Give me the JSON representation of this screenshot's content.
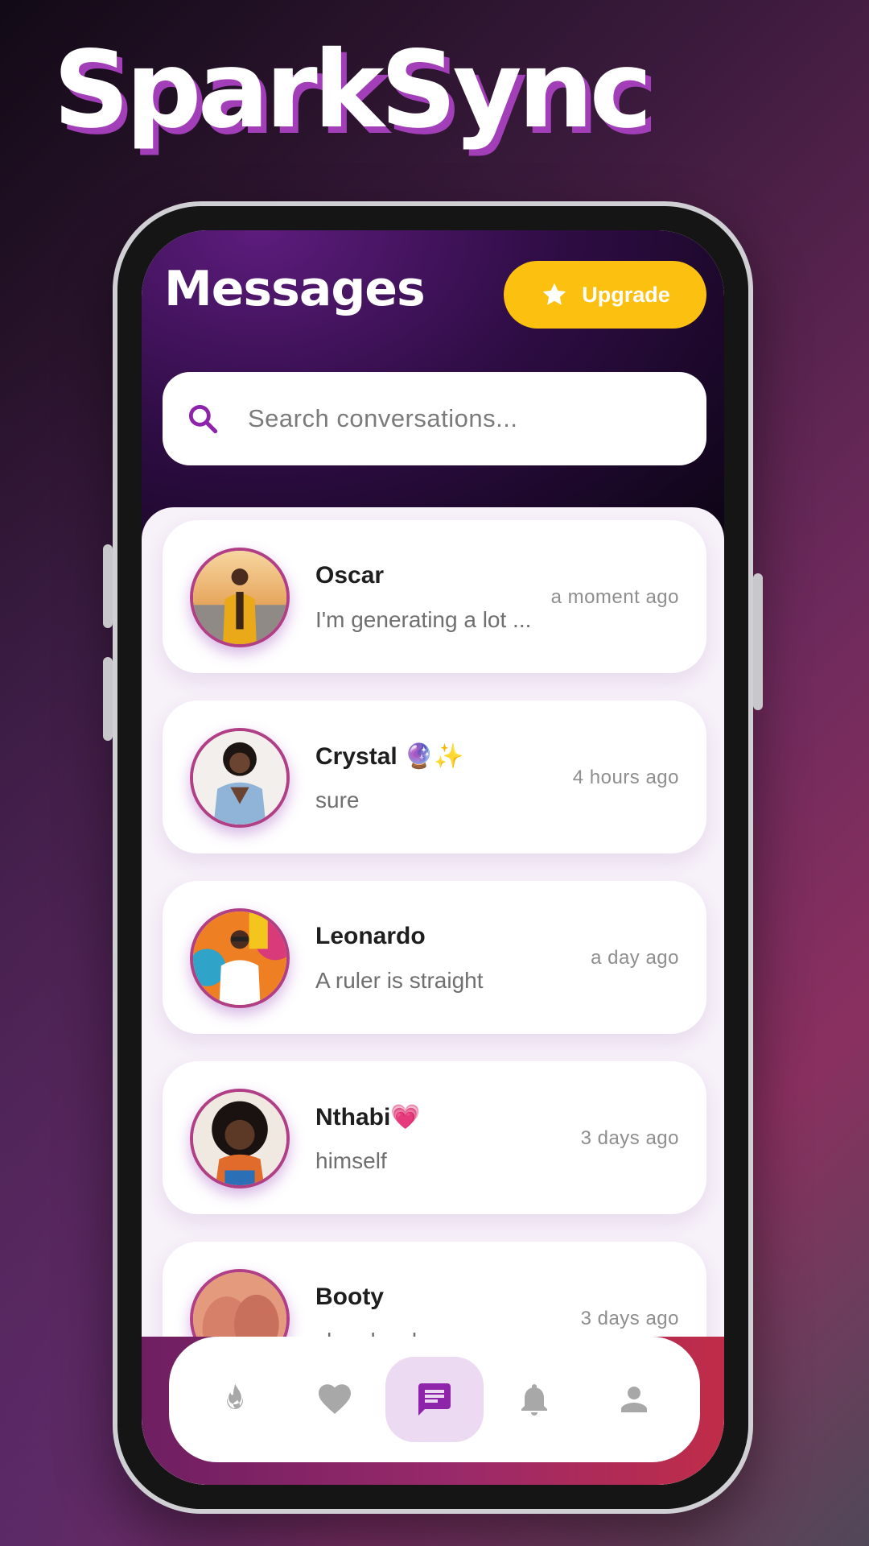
{
  "brand": {
    "name": "SparkSync"
  },
  "header": {
    "title": "Messages",
    "upgrade_label": "Upgrade"
  },
  "search": {
    "placeholder": "Search conversations..."
  },
  "conversations": [
    {
      "name": "Oscar",
      "preview": "I'm generating a lot ...",
      "time": "a moment ago"
    },
    {
      "name": "Crystal 🔮✨",
      "preview": "sure",
      "time": "4 hours ago"
    },
    {
      "name": "Leonardo",
      "preview": "A ruler is straight",
      "time": "a day ago"
    },
    {
      "name": "Nthabi💗",
      "preview": "himself",
      "time": "3 days ago"
    },
    {
      "name": "Booty",
      "preview": "shap ka vbz",
      "time": "3 days ago"
    }
  ],
  "nav": {
    "items": [
      {
        "icon": "flame-icon",
        "active": false
      },
      {
        "icon": "heart-icon",
        "active": false
      },
      {
        "icon": "chat-icon",
        "active": true
      },
      {
        "icon": "bell-icon",
        "active": false
      },
      {
        "icon": "person-icon",
        "active": false
      }
    ]
  },
  "colors": {
    "accent": "#9c27b0",
    "upgrade": "#fcc010",
    "avatar_ring": "#b03f86",
    "active_nav_bg": "#ecd9f2"
  }
}
